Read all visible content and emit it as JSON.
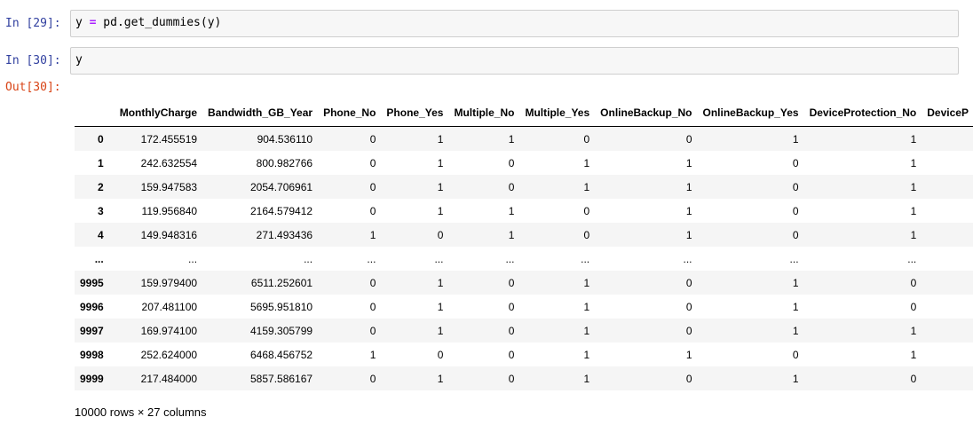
{
  "cells": [
    {
      "prompt": "In [29]:",
      "code_parts": [
        "y ",
        "=",
        " pd.get_dummies(y)"
      ]
    },
    {
      "prompt": "In [30]:",
      "code_parts": [
        "y",
        "",
        ""
      ]
    }
  ],
  "output_prompt": "Out[30]:",
  "table": {
    "columns": [
      "",
      "MonthlyCharge",
      "Bandwidth_GB_Year",
      "Phone_No",
      "Phone_Yes",
      "Multiple_No",
      "Multiple_Yes",
      "OnlineBackup_No",
      "OnlineBackup_Yes",
      "DeviceProtection_No",
      "DeviceP"
    ],
    "rows": [
      [
        "0",
        "172.455519",
        "904.536110",
        "0",
        "1",
        "1",
        "0",
        "0",
        "1",
        "1",
        ""
      ],
      [
        "1",
        "242.632554",
        "800.982766",
        "0",
        "1",
        "0",
        "1",
        "1",
        "0",
        "1",
        ""
      ],
      [
        "2",
        "159.947583",
        "2054.706961",
        "0",
        "1",
        "0",
        "1",
        "1",
        "0",
        "1",
        ""
      ],
      [
        "3",
        "119.956840",
        "2164.579412",
        "0",
        "1",
        "1",
        "0",
        "1",
        "0",
        "1",
        ""
      ],
      [
        "4",
        "149.948316",
        "271.493436",
        "1",
        "0",
        "1",
        "0",
        "1",
        "0",
        "1",
        ""
      ],
      [
        "...",
        "...",
        "...",
        "...",
        "...",
        "...",
        "...",
        "...",
        "...",
        "...",
        ""
      ],
      [
        "9995",
        "159.979400",
        "6511.252601",
        "0",
        "1",
        "0",
        "1",
        "0",
        "1",
        "0",
        ""
      ],
      [
        "9996",
        "207.481100",
        "5695.951810",
        "0",
        "1",
        "0",
        "1",
        "0",
        "1",
        "0",
        ""
      ],
      [
        "9997",
        "169.974100",
        "4159.305799",
        "0",
        "1",
        "0",
        "1",
        "0",
        "1",
        "1",
        ""
      ],
      [
        "9998",
        "252.624000",
        "6468.456752",
        "1",
        "0",
        "0",
        "1",
        "1",
        "0",
        "1",
        ""
      ],
      [
        "9999",
        "217.484000",
        "5857.586167",
        "0",
        "1",
        "0",
        "1",
        "0",
        "1",
        "0",
        ""
      ]
    ]
  },
  "shape_text": "10000 rows × 27 columns"
}
